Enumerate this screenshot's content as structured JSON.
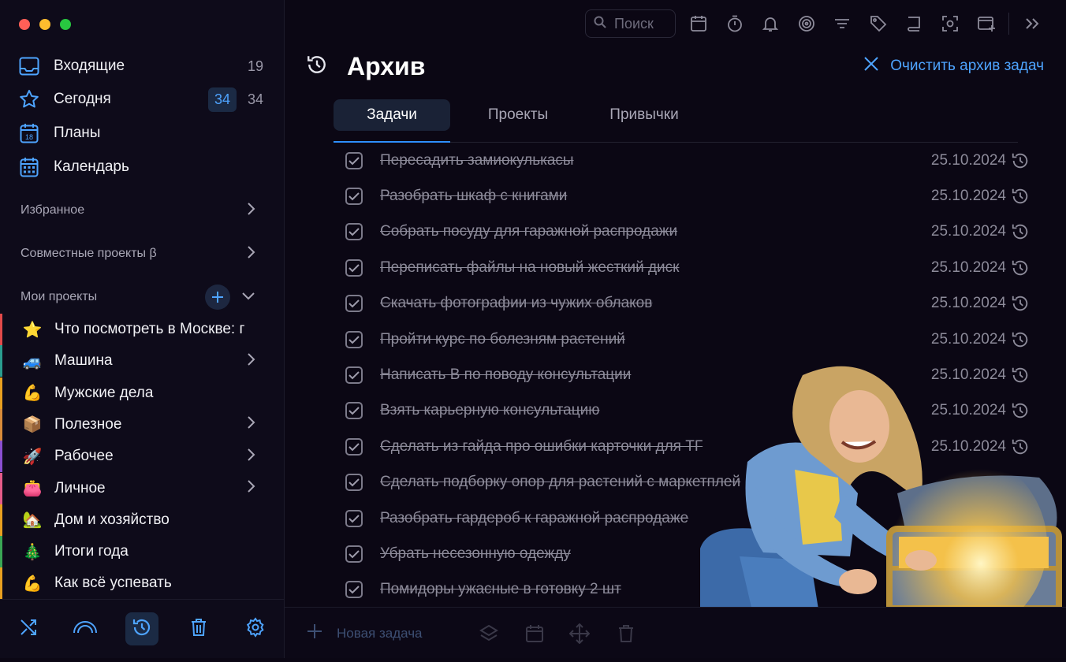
{
  "sidebar": {
    "nav": [
      {
        "label": "Входящие",
        "count": "19",
        "icon": "inbox-icon"
      },
      {
        "label": "Сегодня",
        "badge": "34",
        "count": "34",
        "icon": "star-icon"
      },
      {
        "label": "Планы",
        "icon": "calendar-18-icon"
      },
      {
        "label": "Календарь",
        "icon": "calendar-grid-icon"
      }
    ],
    "favorites": "Избранное",
    "shared": "Совместные проекты β",
    "my_projects": "Мои проекты",
    "projects": [
      {
        "emoji": "⭐",
        "label": "Что посмотреть в Москве: г",
        "color": "#e24a4a",
        "chevron": false
      },
      {
        "emoji": "🚙",
        "label": "Машина",
        "color": "#2a9d8f",
        "chevron": true
      },
      {
        "emoji": "💪",
        "label": "Мужские дела",
        "color": "#e8a020",
        "chevron": false
      },
      {
        "emoji": "📦",
        "label": "Полезное",
        "color": "#d98c3a",
        "chevron": true
      },
      {
        "emoji": "🚀",
        "label": "Рабочее",
        "color": "#8a4fd1",
        "chevron": true
      },
      {
        "emoji": "👛",
        "label": "Личное",
        "color": "#e65c8a",
        "chevron": true
      },
      {
        "emoji": "🏡",
        "label": "Дом и хозяйство",
        "color": "#e8a020",
        "chevron": false
      },
      {
        "emoji": "🎄",
        "label": "Итоги года",
        "color": "#3aa655",
        "chevron": false
      },
      {
        "emoji": "💪",
        "label": "Как всё успевать",
        "color": "#e8a020",
        "chevron": false
      }
    ]
  },
  "toolbar": {
    "search_placeholder": "Поиск"
  },
  "header": {
    "title": "Архив",
    "clear_label": "Очистить архив задач"
  },
  "tabs": [
    "Задачи",
    "Проекты",
    "Привычки"
  ],
  "tasks": [
    {
      "text": "Пересадить замиокулькасы",
      "date": "25.10.2024"
    },
    {
      "text": "Разобрать шкаф с книгами",
      "date": "25.10.2024"
    },
    {
      "text": "Собрать посуду для гаражной распродажи",
      "date": "25.10.2024"
    },
    {
      "text": "Переписать файлы на новый жесткий диск",
      "date": "25.10.2024"
    },
    {
      "text": "Скачать фотографии из чужих облаков",
      "date": "25.10.2024"
    },
    {
      "text": "Пройти курс по болезням растений",
      "date": "25.10.2024"
    },
    {
      "text": "Написать В по поводу консультации",
      "date": "25.10.2024"
    },
    {
      "text": "Взять карьерную консультацию",
      "date": "25.10.2024"
    },
    {
      "text": "Сделать из гайда про ошибки карточки для ТГ",
      "date": "25.10.2024"
    },
    {
      "text": "Сделать подборку опор для растений с маркетплей",
      "date": ""
    },
    {
      "text": "Разобрать гардероб к гаражной распродаже",
      "date": ""
    },
    {
      "text": "Убрать несезонную одежду",
      "date": ""
    },
    {
      "text": "Помидоры ужасные в готовку 2 шт",
      "date": ""
    }
  ],
  "bottom": {
    "new_task": "Новая задача"
  },
  "colors": {
    "accent": "#4ea4ff",
    "background": "#0b0714",
    "sidebar": "#0e0b1a"
  }
}
